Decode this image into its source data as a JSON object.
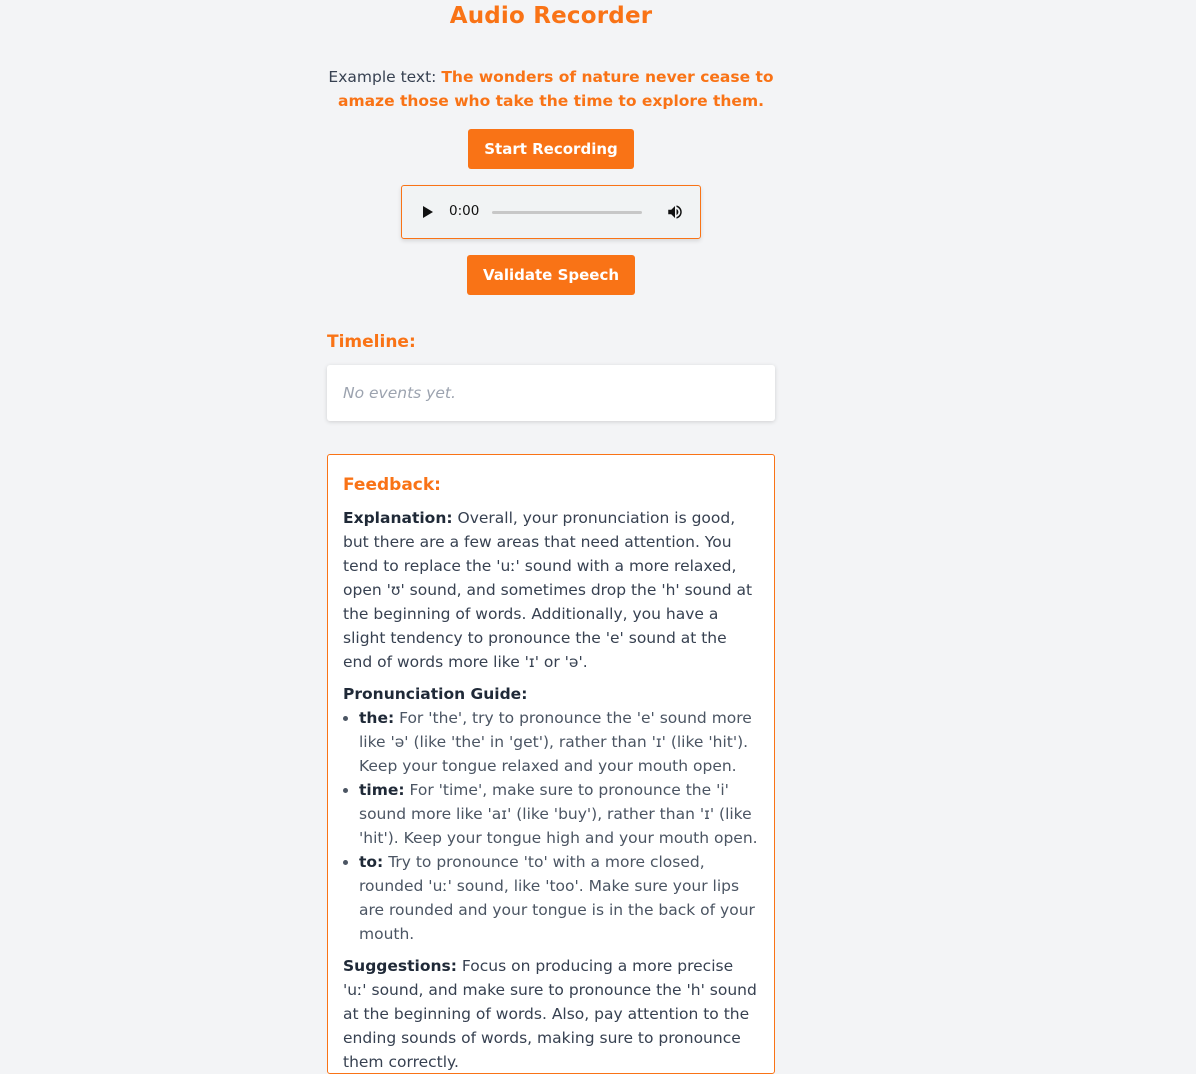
{
  "header": {
    "title": "Audio Recorder"
  },
  "example": {
    "label": "Example text: ",
    "text": "The wonders of nature never cease to amaze those who take the time to explore them."
  },
  "buttons": {
    "start_recording": "Start Recording",
    "validate_speech": "Validate Speech"
  },
  "audio_player": {
    "current_time": "0:00",
    "progress": 0
  },
  "timeline": {
    "title": "Timeline:",
    "empty_text": "No events yet."
  },
  "feedback": {
    "title": "Feedback:",
    "explanation_label": "Explanation:",
    "explanation_text": " Overall, your pronunciation is good, but there are a few areas that need attention. You tend to replace the 'uː' sound with a more relaxed, open 'ʊ' sound, and sometimes drop the 'h' sound at the beginning of words. Additionally, you have a slight tendency to pronounce the 'e' sound at the end of words more like 'ɪ' or 'ə'.",
    "guide_label": "Pronunciation Guide:",
    "guide_items": [
      {
        "word": "the:",
        "text": " For 'the', try to pronounce the 'e' sound more like 'ə' (like 'the' in 'get'), rather than 'ɪ' (like 'hit'). Keep your tongue relaxed and your mouth open."
      },
      {
        "word": "time:",
        "text": " For 'time', make sure to pronounce the 'i' sound more like 'aɪ' (like 'buy'), rather than 'ɪ' (like 'hit'). Keep your tongue high and your mouth open."
      },
      {
        "word": "to:",
        "text": " Try to pronounce 'to' with a more closed, rounded 'uː' sound, like 'too'. Make sure your lips are rounded and your tongue is in the back of your mouth."
      }
    ],
    "suggestions_label": "Suggestions:",
    "suggestions_text": " Focus on producing a more precise 'uː' sound, and make sure to pronounce the 'h' sound at the beginning of words. Also, pay attention to the ending sounds of words, making sure to pronounce them correctly."
  },
  "colors": {
    "accent": "#f97316",
    "background": "#f3f4f6"
  },
  "icons": {
    "play": "play-icon",
    "volume": "volume-icon"
  }
}
